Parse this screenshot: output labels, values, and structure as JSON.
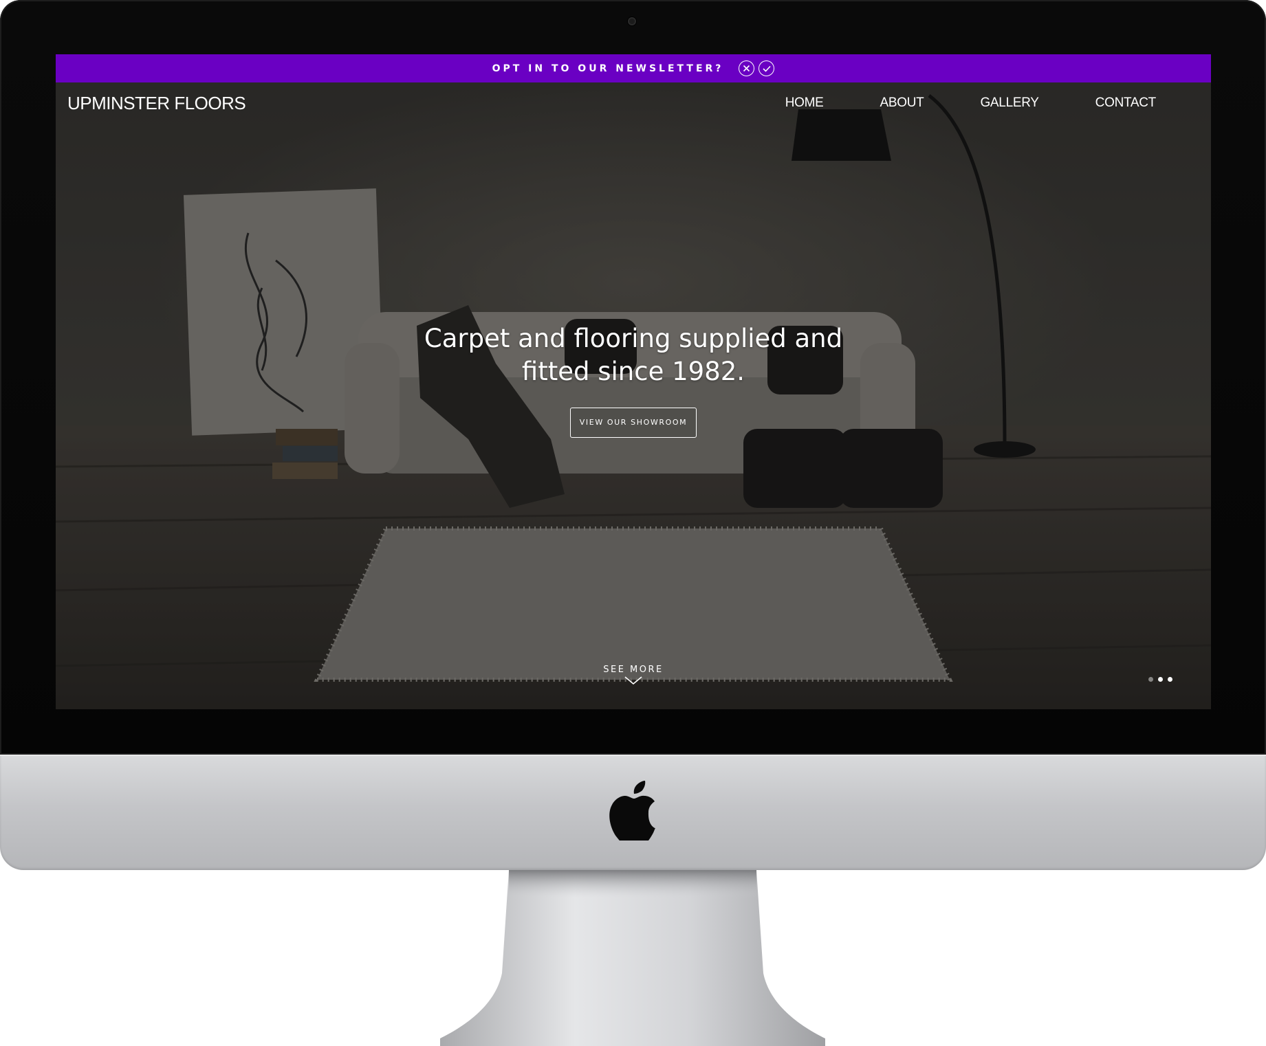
{
  "newsletter": {
    "text": "OPT IN TO OUR NEWSLETTER?",
    "dismiss_icon": "close-circle-icon",
    "accept_icon": "check-circle-icon",
    "bar_color": "#6a00c3"
  },
  "header": {
    "brand": "UPMINSTER FLOORS",
    "nav": [
      {
        "label": "HOME"
      },
      {
        "label": "ABOUT"
      },
      {
        "label": "GALLERY"
      },
      {
        "label": "CONTACT"
      }
    ]
  },
  "hero": {
    "title": "Carpet and flooring supplied and fitted since 1982.",
    "cta_label": "VIEW OUR SHOWROOM",
    "see_more_label": "SEE MORE",
    "see_more_icon": "chevron-down-icon",
    "background_image": "living-room-sofa-rug-photo",
    "slides_total": 3,
    "active_slide": 2
  },
  "device": {
    "frame": "imac",
    "logo_icon": "apple-logo-icon"
  }
}
